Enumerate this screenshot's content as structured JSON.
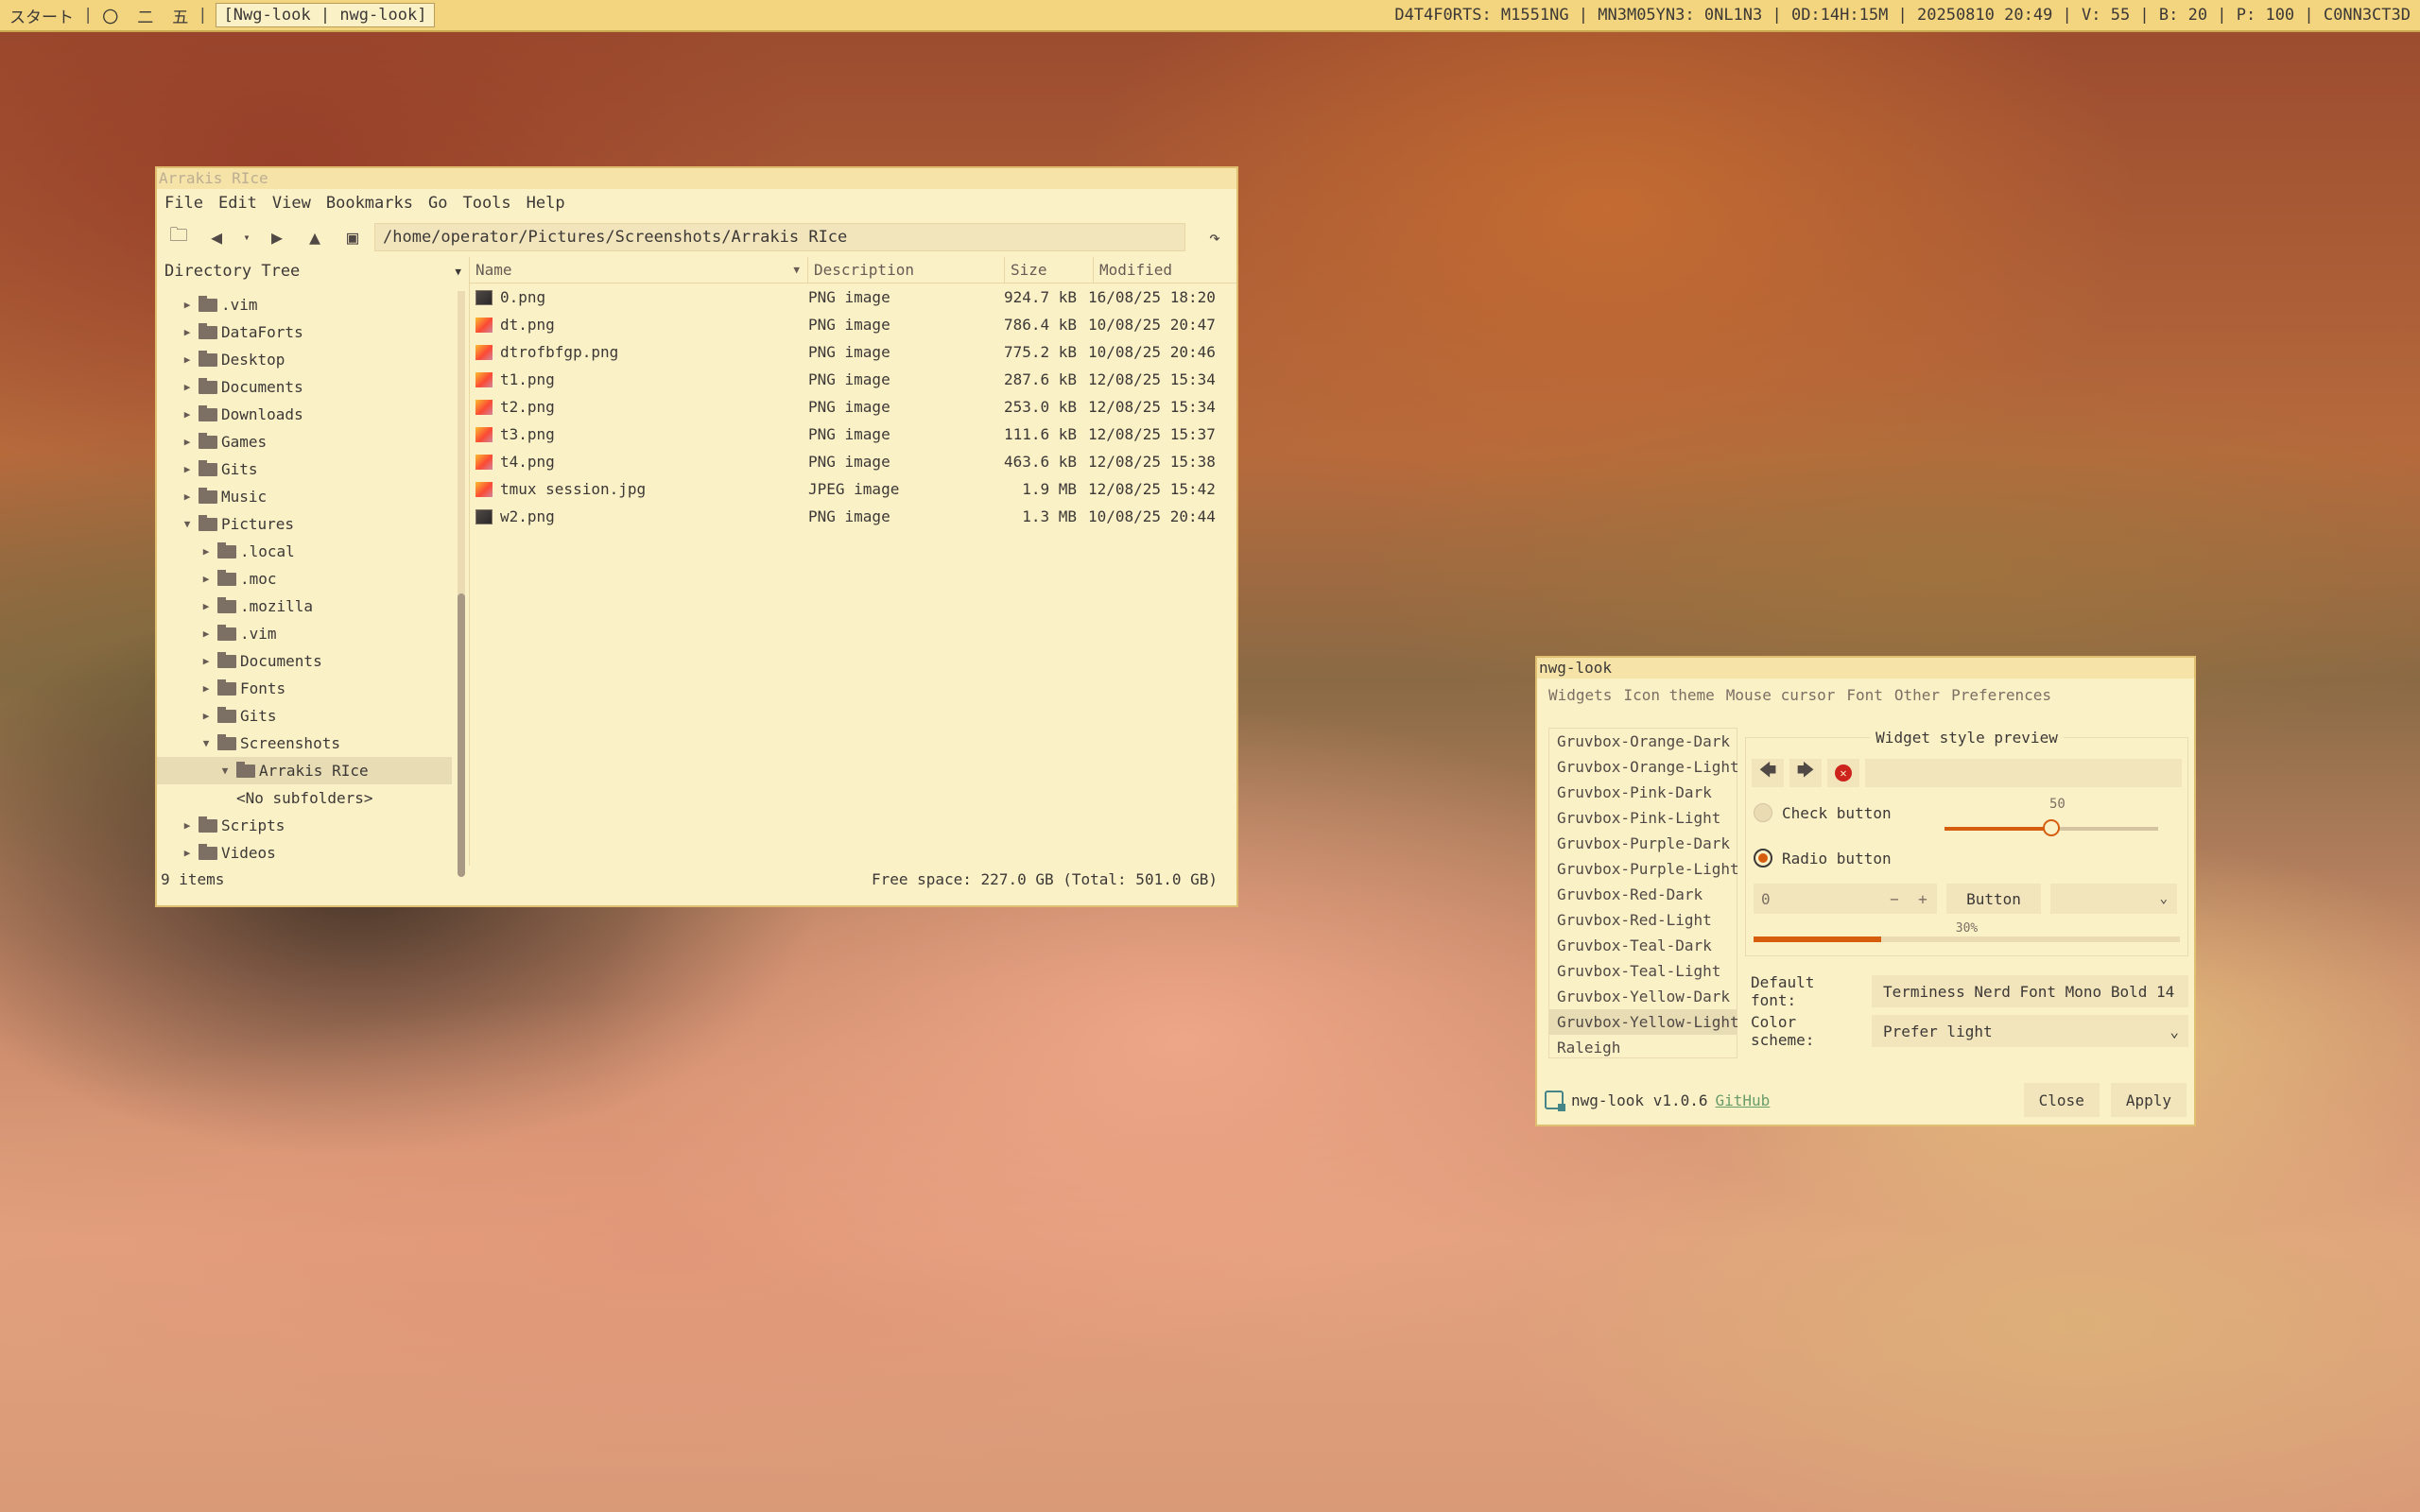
{
  "topbar": {
    "start": "スタート",
    "sep": "|",
    "ws1": "〇",
    "ws2": "二",
    "ws3": "五",
    "window_title": "[Nwg-look | nwg-look]",
    "status": "D4T4F0RTS: M1551NG | MN3M05YN3: 0NL1N3 | 0D:14H:15M | 20250810 20:49 | V: 55 | B: 20 | P: 100 | C0NN3CT3D"
  },
  "file_manager": {
    "title": "Arrakis RIce",
    "menu": [
      "File",
      "Edit",
      "View",
      "Bookmarks",
      "Go",
      "Tools",
      "Help"
    ],
    "location": "/home/operator/Pictures/Screenshots/Arrakis RIce",
    "sidebar_title": "Directory Tree",
    "tree": [
      {
        "label": ".vim",
        "indent": 1
      },
      {
        "label": "DataForts",
        "indent": 1
      },
      {
        "label": "Desktop",
        "indent": 1
      },
      {
        "label": "Documents",
        "indent": 1
      },
      {
        "label": "Downloads",
        "indent": 1
      },
      {
        "label": "Games",
        "indent": 1
      },
      {
        "label": "Gits",
        "indent": 1
      },
      {
        "label": "Music",
        "indent": 1
      },
      {
        "label": "Pictures",
        "indent": 1,
        "open": true
      },
      {
        "label": ".local",
        "indent": 2
      },
      {
        "label": ".moc",
        "indent": 2
      },
      {
        "label": ".mozilla",
        "indent": 2
      },
      {
        "label": ".vim",
        "indent": 2
      },
      {
        "label": "Documents",
        "indent": 2
      },
      {
        "label": "Fonts",
        "indent": 2
      },
      {
        "label": "Gits",
        "indent": 2
      },
      {
        "label": "Screenshots",
        "indent": 2,
        "open": true
      },
      {
        "label": "Arrakis RIce",
        "indent": 3,
        "open": true,
        "selected": true
      },
      {
        "label": "<No subfolders>",
        "indent": 4,
        "nofolder": true
      },
      {
        "label": "Scripts",
        "indent": 1
      },
      {
        "label": "Videos",
        "indent": 1
      },
      {
        "label": "/",
        "indent": 0
      }
    ],
    "columns": {
      "name": "Name",
      "description": "Description",
      "size": "Size",
      "modified": "Modified"
    },
    "files": [
      {
        "name": "0.png",
        "desc": "PNG image",
        "size": "924.7 kB",
        "modified": "16/08/25 18:20",
        "icon": "dark"
      },
      {
        "name": "dt.png",
        "desc": "PNG image",
        "size": "786.4 kB",
        "modified": "10/08/25 20:47",
        "icon": "color"
      },
      {
        "name": "dtrofbfgp.png",
        "desc": "PNG image",
        "size": "775.2 kB",
        "modified": "10/08/25 20:46",
        "icon": "color"
      },
      {
        "name": "t1.png",
        "desc": "PNG image",
        "size": "287.6 kB",
        "modified": "12/08/25 15:34",
        "icon": "color"
      },
      {
        "name": "t2.png",
        "desc": "PNG image",
        "size": "253.0 kB",
        "modified": "12/08/25 15:34",
        "icon": "color"
      },
      {
        "name": "t3.png",
        "desc": "PNG image",
        "size": "111.6 kB",
        "modified": "12/08/25 15:37",
        "icon": "color"
      },
      {
        "name": "t4.png",
        "desc": "PNG image",
        "size": "463.6 kB",
        "modified": "12/08/25 15:38",
        "icon": "color"
      },
      {
        "name": "tmux session.jpg",
        "desc": "JPEG image",
        "size": "1.9 MB",
        "modified": "12/08/25 15:42",
        "icon": "color"
      },
      {
        "name": "w2.png",
        "desc": "PNG image",
        "size": "1.3 MB",
        "modified": "10/08/25 20:44",
        "icon": "dark"
      }
    ],
    "item_count": "9 items",
    "free_space": "Free space: 227.0 GB (Total: 501.0 GB)"
  },
  "nwg": {
    "title": "nwg-look",
    "tabs": [
      "Widgets",
      "Icon theme",
      "Mouse cursor",
      "Font",
      "Other",
      "Preferences"
    ],
    "themes": [
      "Gruvbox-Orange-Dark",
      "Gruvbox-Orange-Light",
      "Gruvbox-Pink-Dark",
      "Gruvbox-Pink-Light",
      "Gruvbox-Purple-Dark",
      "Gruvbox-Purple-Light",
      "Gruvbox-Red-Dark",
      "Gruvbox-Red-Light",
      "Gruvbox-Teal-Dark",
      "Gruvbox-Teal-Light",
      "Gruvbox-Yellow-Dark",
      "Gruvbox-Yellow-Light",
      "Raleigh"
    ],
    "selected_theme": "Gruvbox-Yellow-Light",
    "preview_title": "Widget style preview",
    "check_label": "Check button",
    "radio_label": "Radio button",
    "slider_value": "50",
    "slider_fraction": 0.5,
    "spin_value": "0",
    "spin_minus": "−",
    "spin_plus": "+",
    "button_label": "Button",
    "progress_label": "30%",
    "progress_fraction": 0.3,
    "default_font_label": "Default font:",
    "default_font_value": "Terminess Nerd Font Mono Bold 14",
    "color_scheme_label": "Color scheme:",
    "color_scheme_value": "Prefer light",
    "version": "nwg-look v1.0.6",
    "github": "GitHub",
    "close": "Close",
    "apply": "Apply"
  }
}
